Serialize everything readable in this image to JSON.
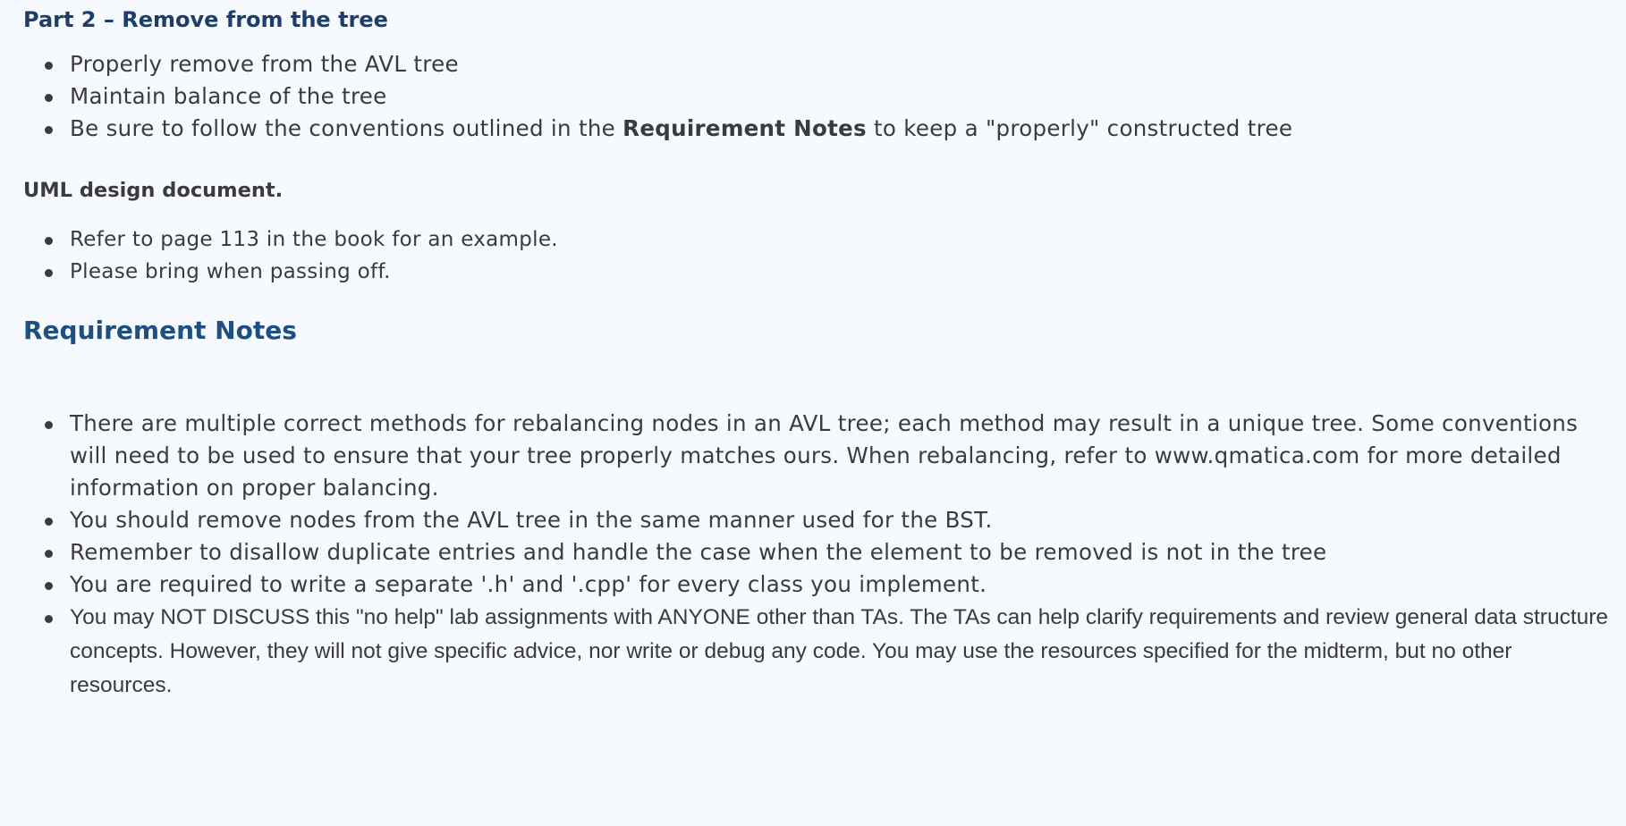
{
  "part2": {
    "heading": "Part 2 – Remove from the tree",
    "items": [
      "Properly remove from the AVL tree",
      "Maintain balance of the tree"
    ],
    "item3": {
      "before": "Be sure to follow the conventions outlined in the ",
      "bold": "Requirement Notes",
      "after": " to keep a \"properly\" constructed tree"
    }
  },
  "uml": {
    "heading": "UML design document.",
    "items": [
      "Refer to page 113 in the book for an example.",
      "Please bring when passing off."
    ]
  },
  "requirement_notes": {
    "heading": "Requirement Notes",
    "items": [
      "There are multiple correct methods for rebalancing nodes in an AVL tree; each method may result in a unique tree. Some conventions will need to be used to ensure that your tree properly matches ours. When rebalancing, refer to www.qmatica.com for more detailed information on proper balancing.",
      "You should remove nodes from the AVL tree in the same manner used for the BST.",
      "Remember to disallow duplicate entries and handle the case when the element to be removed is not in the tree",
      "You are required to write a separate '.h' and '.cpp' for every class you implement.",
      "You may NOT DISCUSS this \"no help\" lab assignments with ANYONE other than TAs. The TAs can help clarify requirements and review general data structure concepts. However, they will not give specific advice, nor write or debug any code.  You may use the resources specified for the midterm, but no other resources."
    ]
  }
}
